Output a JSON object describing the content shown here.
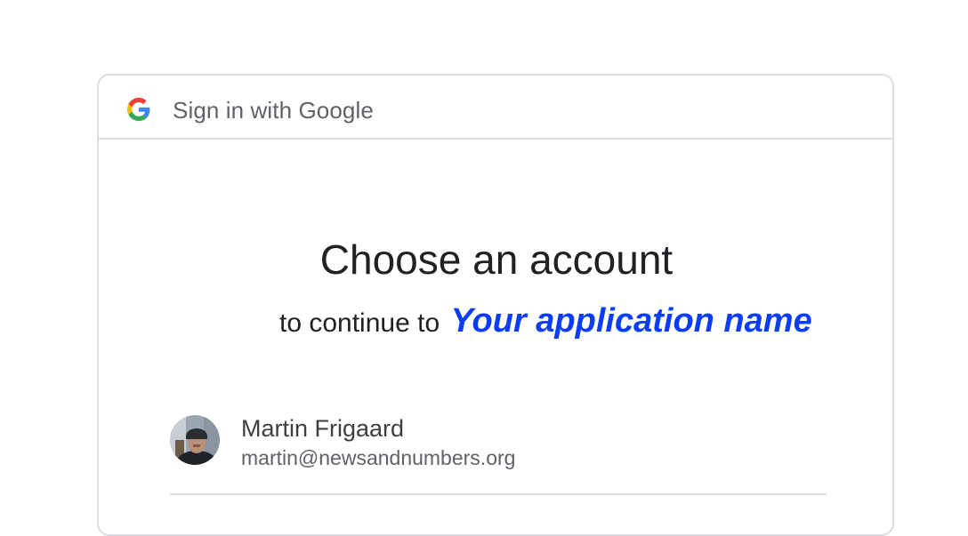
{
  "header": {
    "logo_icon": "google-g-icon",
    "title": "Sign in with Google"
  },
  "main": {
    "title": "Choose an account",
    "continue_prefix": "to continue to",
    "app_name": "Your application name",
    "app_name_color": "#0b3df7"
  },
  "accounts": [
    {
      "avatar_icon": "avatar",
      "name": "Martin Frigaard",
      "email": "martin@newsandnumbers.org"
    }
  ]
}
